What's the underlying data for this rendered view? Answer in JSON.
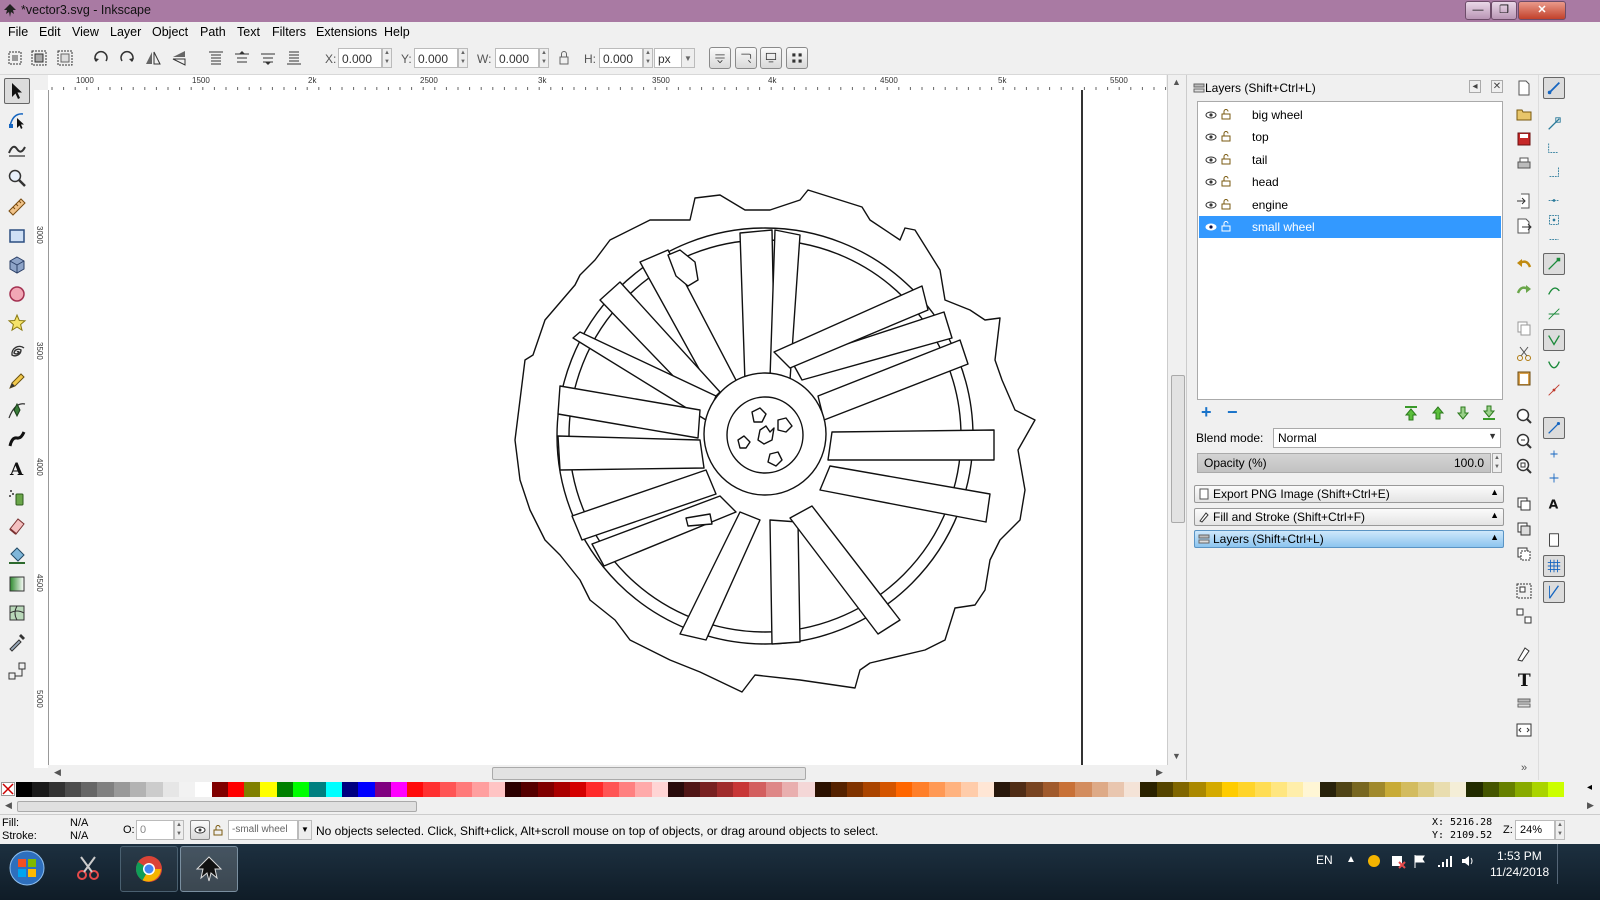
{
  "window": {
    "title": "*vector3.svg - Inkscape",
    "buttons": {
      "minimize": "—",
      "maximize": "❐",
      "close": "✕"
    }
  },
  "menu": {
    "items": [
      "File",
      "Edit",
      "View",
      "Layer",
      "Object",
      "Path",
      "Text",
      "Filters",
      "Extensions",
      "Help"
    ]
  },
  "toolbar": {
    "x_label": "X:",
    "x_value": "0.000",
    "y_label": "Y:",
    "y_value": "0.000",
    "w_label": "W:",
    "w_value": "0.000",
    "h_label": "H:",
    "h_value": "0.000",
    "unit": "px"
  },
  "ruler": {
    "top_ticks": [
      "1000",
      "1500",
      "2k",
      "2500",
      "3k",
      "3500",
      "4k",
      "4500",
      "5k",
      "5500"
    ],
    "left_ticks": [
      "3000",
      "3500",
      "4000",
      "4500",
      "5000"
    ]
  },
  "layers_panel": {
    "title": "Layers (Shift+Ctrl+L)",
    "layers": [
      {
        "name": "big wheel",
        "selected": false
      },
      {
        "name": "top",
        "selected": false
      },
      {
        "name": "tail",
        "selected": false
      },
      {
        "name": "head",
        "selected": false
      },
      {
        "name": "engine",
        "selected": false
      },
      {
        "name": "small wheel",
        "selected": true
      }
    ],
    "blend_label": "Blend mode:",
    "blend_value": "Normal",
    "opacity_label": "Opacity (%)",
    "opacity_value": "100.0",
    "tabs": [
      {
        "label": "Export PNG Image (Shift+Ctrl+E)",
        "active": false
      },
      {
        "label": "Fill and Stroke (Shift+Ctrl+F)",
        "active": false
      },
      {
        "label": "Layers (Shift+Ctrl+L)",
        "active": true
      }
    ]
  },
  "palette": {
    "colors": [
      "#000000",
      "#1a1a1a",
      "#333333",
      "#4d4d4d",
      "#666666",
      "#808080",
      "#999999",
      "#b3b3b3",
      "#cccccc",
      "#e6e6e6",
      "#f2f2f2",
      "#ffffff",
      "#800000",
      "#ff0000",
      "#808000",
      "#ffff00",
      "#008000",
      "#00ff00",
      "#008080",
      "#00ffff",
      "#000080",
      "#0000ff",
      "#800080",
      "#ff00ff",
      "#ff0a0a",
      "#ff3030",
      "#ff5555",
      "#ff7a7a",
      "#ff9f9f",
      "#ffc4c4",
      "#2b0000",
      "#550000",
      "#800000",
      "#aa0000",
      "#d40000",
      "#ff2a2a",
      "#ff5555",
      "#ff8080",
      "#ffaaaa",
      "#ffd5d5",
      "#280b0b",
      "#501616",
      "#782121",
      "#a02c2c",
      "#c83737",
      "#d35f5f",
      "#de8787",
      "#e9afaf",
      "#f4d7d7",
      "#2b1100",
      "#552200",
      "#803300",
      "#aa4400",
      "#d45500",
      "#ff6600",
      "#ff7f2a",
      "#ff9955",
      "#ffb380",
      "#ffccaa",
      "#ffe6d5",
      "#28170b",
      "#502d16",
      "#784421",
      "#a05a2c",
      "#c87137",
      "#d38d5f",
      "#deaa87",
      "#e9c6af",
      "#f4e3d7",
      "#2b2200",
      "#554400",
      "#806600",
      "#aa8800",
      "#d4aa00",
      "#ffcc00",
      "#ffd42a",
      "#ffdd55",
      "#ffe680",
      "#ffeeaa",
      "#fff6d5",
      "#28220b",
      "#504416",
      "#786721",
      "#a0892c",
      "#c8ab37",
      "#d3bc5f",
      "#decd87",
      "#e9ddaf",
      "#f4eed7",
      "#222b00",
      "#445500",
      "#668000",
      "#88aa00",
      "#aad400",
      "#ccff00"
    ]
  },
  "status": {
    "fill_label": "Fill:",
    "fill_value": "N/A",
    "stroke_label": "Stroke:",
    "stroke_value": "N/A",
    "o_label": "O:",
    "o_value": "0",
    "layer_select": "-small wheel",
    "message": "No objects selected. Click, Shift+click, Alt+scroll mouse on top of objects, or drag around objects to select.",
    "x_coord": "X: 5216.28",
    "y_coord": "Y: 2109.52",
    "zoom_label": "Z:",
    "zoom_value": "24%"
  },
  "taskbar": {
    "language": "EN",
    "time": "1:53 PM",
    "date": "11/24/2018"
  },
  "colors": {
    "titlebar": "#a97aa3",
    "selection": "#3399ff",
    "active_tab": "#8cc4ef"
  }
}
